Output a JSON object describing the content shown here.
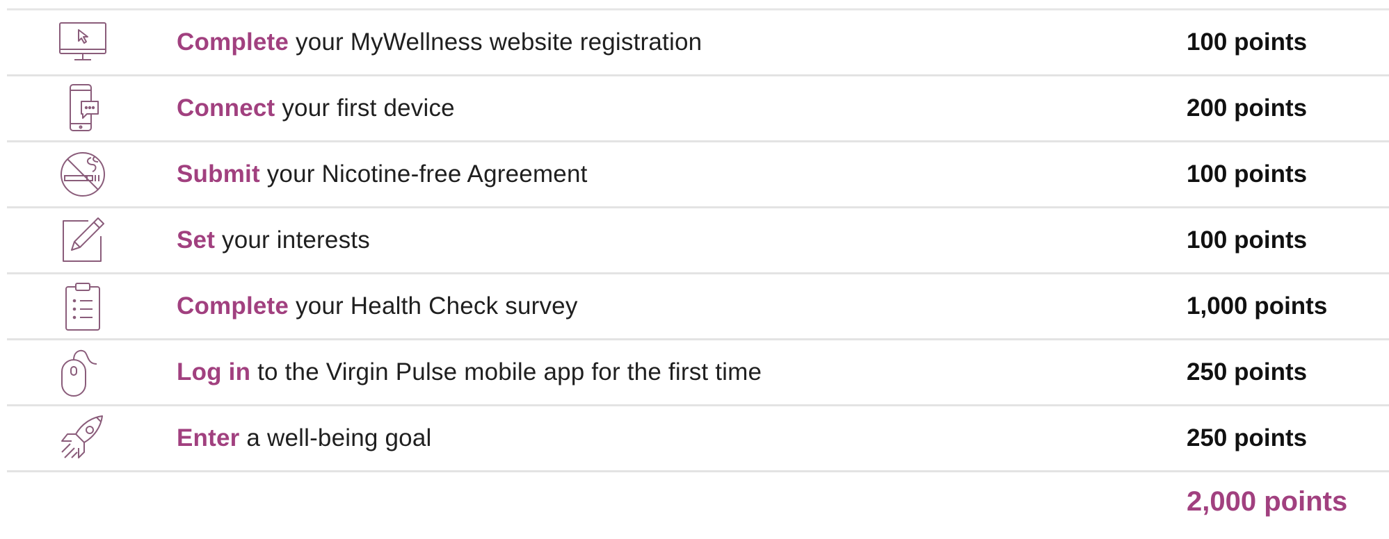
{
  "colors": {
    "accent": "#a1407f",
    "icon_stroke": "#8a5c7a",
    "text": "#1f1f1f",
    "rule": "#e3e3e3"
  },
  "tasks": [
    {
      "action": "Complete",
      "rest": " your MyWellness website registration",
      "points": "100 points",
      "icon": "computer-monitor-icon"
    },
    {
      "action": "Connect",
      "rest": " your first device",
      "points": "200 points",
      "icon": "smartphone-chat-icon"
    },
    {
      "action": "Submit",
      "rest": " your Nicotine-free Agreement",
      "points": "100 points",
      "icon": "no-smoking-icon"
    },
    {
      "action": "Set",
      "rest": " your interests",
      "points": "100 points",
      "icon": "pencil-edit-icon"
    },
    {
      "action": "Complete",
      "rest": " your Health Check survey",
      "points": "1,000 points",
      "icon": "clipboard-list-icon"
    },
    {
      "action": "Log in",
      "rest": " to the Virgin Pulse mobile app for the first time",
      "points": "250 points",
      "icon": "computer-mouse-icon"
    },
    {
      "action": "Enter",
      "rest": " a well-being goal",
      "points": "250 points",
      "icon": "rocket-icon"
    }
  ],
  "total": "2,000 points"
}
